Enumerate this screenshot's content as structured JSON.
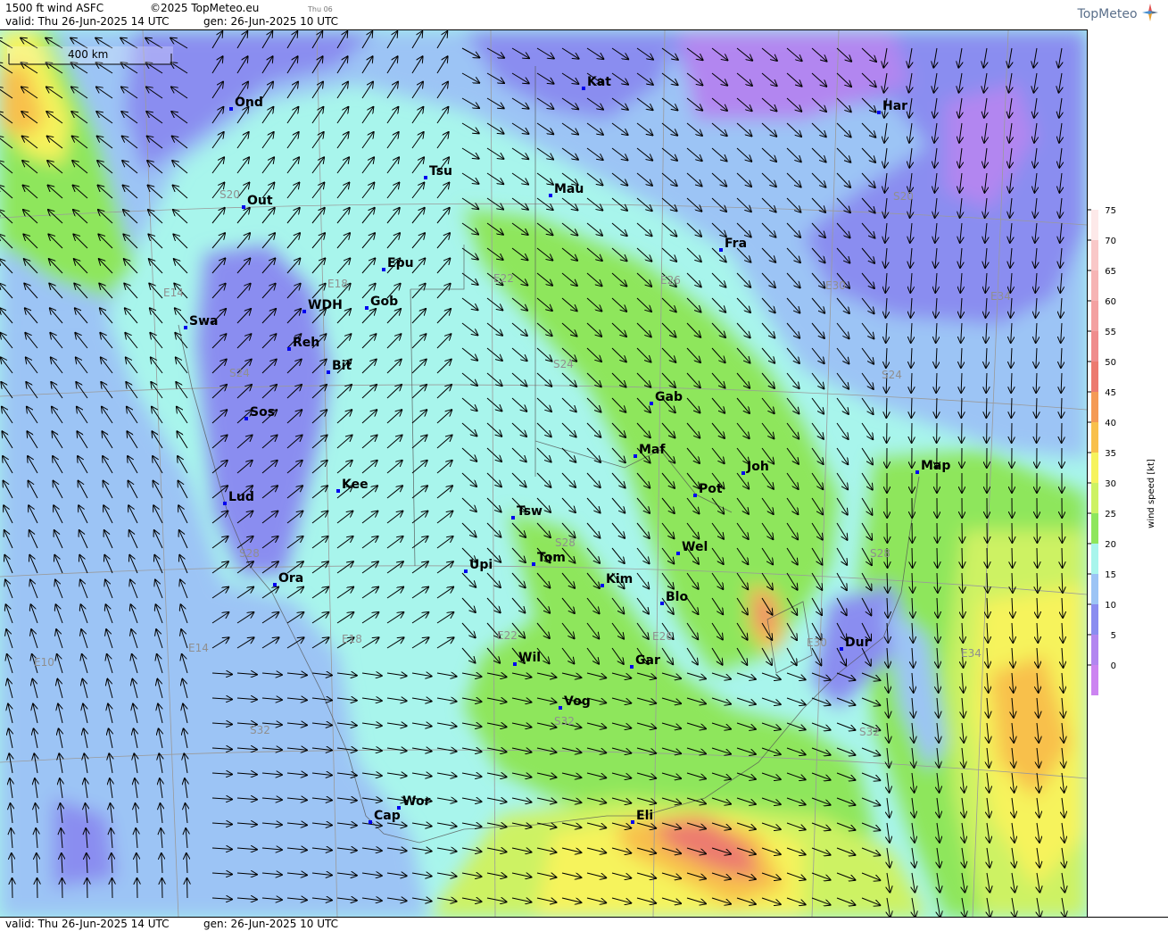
{
  "header": {
    "title": "1500 ft wind ASFC",
    "copyright": "©2025 TopMeteo.eu",
    "day_tag": "Thu 06",
    "valid": "valid:  Thu  26-Jun-2025  14 UTC",
    "gen": "gen: 26-Jun-2025 10 UTC",
    "logo_text": "TopMeteo"
  },
  "footer": {
    "valid": "valid:  Thu  26-Jun-2025  14 UTC",
    "gen": "gen: 26-Jun-2025 10 UTC"
  },
  "scale_bar": {
    "label": "400 km"
  },
  "legend": {
    "title": "wind speed  [kt]",
    "ticks": [
      "75",
      "70",
      "65",
      "60",
      "55",
      "50",
      "45",
      "40",
      "35",
      "30",
      "25",
      "20",
      "15",
      "10",
      "5",
      "0"
    ],
    "colors": [
      "#fde9e9",
      "#f9c8c8",
      "#f6b4b4",
      "#f3a1a1",
      "#ef8c8c",
      "#ec7a6f",
      "#f49a55",
      "#f8c04c",
      "#f6f35c",
      "#cdf263",
      "#8ee65c",
      "#a8f5ec",
      "#9cc4f5",
      "#8a8df0",
      "#b286f0",
      "#cc84f1"
    ]
  },
  "cities": [
    {
      "code": "Ond"
    },
    {
      "code": "Kat"
    },
    {
      "code": "Har"
    },
    {
      "code": "Tsu"
    },
    {
      "code": "Mau"
    },
    {
      "code": "Out"
    },
    {
      "code": "Fra"
    },
    {
      "code": "Epu"
    },
    {
      "code": "Gob"
    },
    {
      "code": "WDH"
    },
    {
      "code": "Swa"
    },
    {
      "code": "Reh"
    },
    {
      "code": "Bit"
    },
    {
      "code": "Gab"
    },
    {
      "code": "Sos"
    },
    {
      "code": "Maf"
    },
    {
      "code": "Joh"
    },
    {
      "code": "Map"
    },
    {
      "code": "Pot"
    },
    {
      "code": "Kee"
    },
    {
      "code": "Lud"
    },
    {
      "code": "Tsw"
    },
    {
      "code": "Wel"
    },
    {
      "code": "Upi"
    },
    {
      "code": "Tom"
    },
    {
      "code": "Kim"
    },
    {
      "code": "Ora"
    },
    {
      "code": "Blo"
    },
    {
      "code": "Dur"
    },
    {
      "code": "Wil"
    },
    {
      "code": "Gar"
    },
    {
      "code": "Vog"
    },
    {
      "code": "Wor"
    },
    {
      "code": "Cap"
    },
    {
      "code": "Eli"
    }
  ],
  "grid_labels": {
    "lat": [
      "S20",
      "S20",
      "S20",
      "S24",
      "S24",
      "S24",
      "S28",
      "S28",
      "S28",
      "S32",
      "S32",
      "S32"
    ],
    "lon": [
      "E14",
      "E18",
      "E22",
      "E26",
      "E30",
      "E34",
      "E10",
      "E14",
      "E18",
      "E22",
      "E26",
      "E30",
      "E34"
    ]
  }
}
